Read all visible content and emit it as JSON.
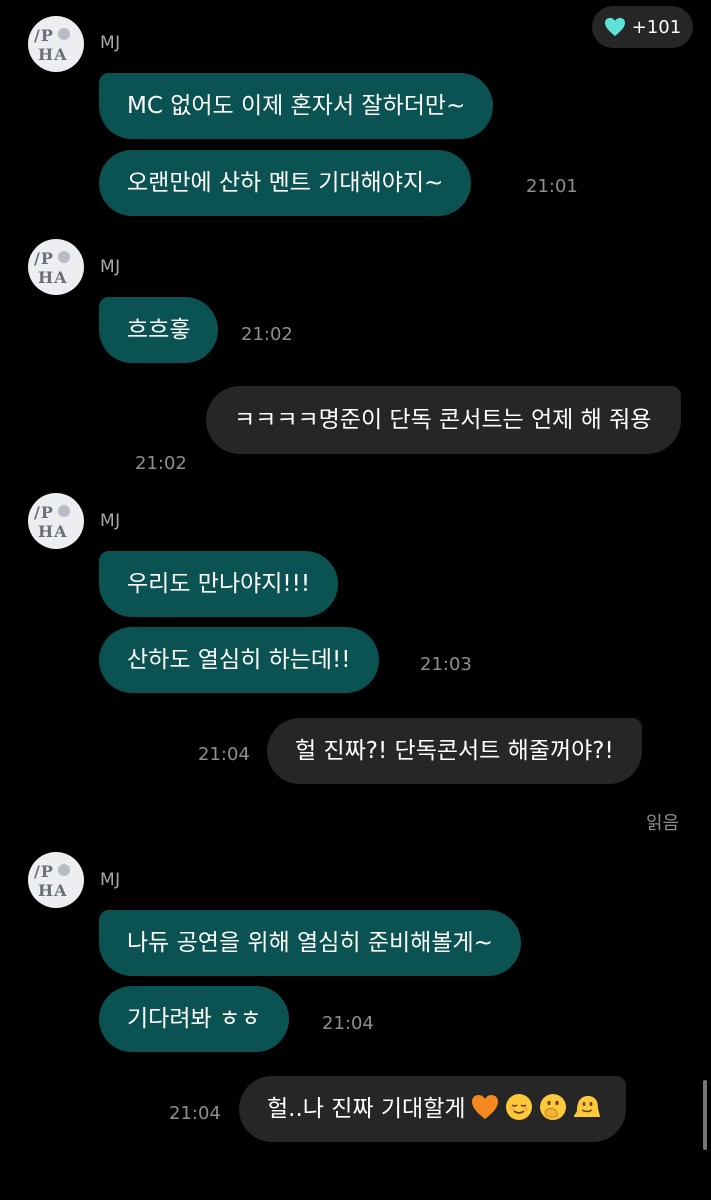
{
  "header": {
    "reaction_count": "+101",
    "reaction_icon": "heart-icon",
    "reaction_color": "#5fe3d5"
  },
  "colors": {
    "incoming_bubble": "#0b5252",
    "outgoing_bubble": "#262626",
    "background": "#000000"
  },
  "messages": [
    {
      "sender": "MJ",
      "texts": [
        "MC 없어도 이제 혼자서 잘하더만~",
        "오랜만에 산하 멘트 기대해야지~"
      ],
      "time": "21:01"
    },
    {
      "sender": "MJ",
      "texts": [
        "흐흐흫"
      ],
      "time": "21:02"
    },
    {
      "me": true,
      "text": "ㅋㅋㅋㅋ명준이 단독 콘서트는 언제 해 줘용",
      "time": "21:02"
    },
    {
      "sender": "MJ",
      "texts": [
        "우리도 만나야지!!!",
        "산하도 열심히 하는데!!"
      ],
      "time": "21:03"
    },
    {
      "me": true,
      "text": "헐 진짜?! 단독콘서트 해줄꺼야?!",
      "time": "21:04",
      "status": "읽음"
    },
    {
      "sender": "MJ",
      "texts": [
        "나듀 공연을 위해 열심히 준비해볼게~",
        "기다려봐 ㅎㅎ"
      ],
      "time": "21:04"
    },
    {
      "me": true,
      "text": "헐..나 진짜 기대할게",
      "emojis": [
        "orange-heart",
        "relieved-face",
        "face-with-hand-over-mouth",
        "melting-face"
      ],
      "time": "21:04"
    }
  ]
}
